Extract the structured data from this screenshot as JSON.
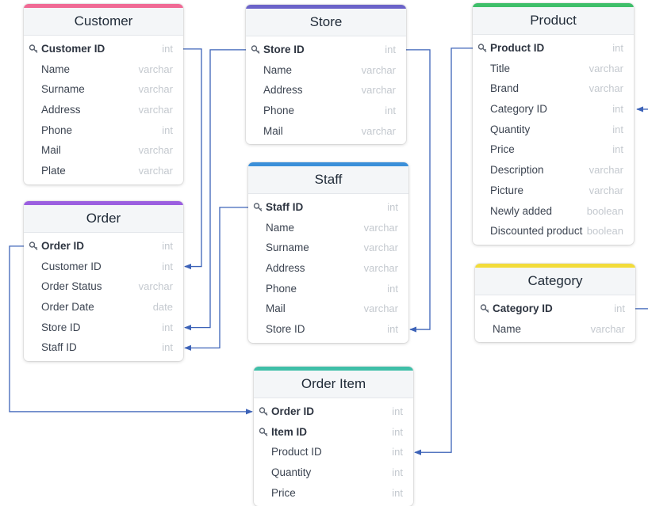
{
  "tables": [
    {
      "id": "customer",
      "name": "Customer",
      "color": "#f06a95",
      "fields": [
        {
          "name": "Customer ID",
          "type": "int",
          "pk": true
        },
        {
          "name": "Name",
          "type": "varchar"
        },
        {
          "name": "Surname",
          "type": "varchar"
        },
        {
          "name": "Address",
          "type": "varchar"
        },
        {
          "name": "Phone",
          "type": "int"
        },
        {
          "name": "Mail",
          "type": "varchar"
        },
        {
          "name": "Plate",
          "type": "varchar"
        }
      ]
    },
    {
      "id": "store",
      "name": "Store",
      "color": "#6b63c9",
      "fields": [
        {
          "name": "Store ID",
          "type": "int",
          "pk": true
        },
        {
          "name": "Name",
          "type": "varchar"
        },
        {
          "name": "Address",
          "type": "varchar"
        },
        {
          "name": "Phone",
          "type": "int"
        },
        {
          "name": "Mail",
          "type": "varchar"
        }
      ]
    },
    {
      "id": "product",
      "name": "Product",
      "color": "#3fbf6a",
      "fields": [
        {
          "name": "Product ID",
          "type": "int",
          "pk": true
        },
        {
          "name": "Title",
          "type": "varchar"
        },
        {
          "name": "Brand",
          "type": "varchar"
        },
        {
          "name": "Category ID",
          "type": "int"
        },
        {
          "name": "Quantity",
          "type": "int"
        },
        {
          "name": "Price",
          "type": "int"
        },
        {
          "name": "Description",
          "type": "varchar"
        },
        {
          "name": "Picture",
          "type": "varchar"
        },
        {
          "name": "Newly added",
          "type": "boolean"
        },
        {
          "name": "Discounted product",
          "type": "boolean"
        }
      ]
    },
    {
      "id": "order",
      "name": "Order",
      "color": "#9b5fe0",
      "fields": [
        {
          "name": "Order ID",
          "type": "int",
          "pk": true
        },
        {
          "name": "Customer ID",
          "type": "int"
        },
        {
          "name": "Order Status",
          "type": "varchar"
        },
        {
          "name": "Order Date",
          "type": "date"
        },
        {
          "name": "Store ID",
          "type": "int"
        },
        {
          "name": "Staff ID",
          "type": "int"
        }
      ]
    },
    {
      "id": "staff",
      "name": "Staff",
      "color": "#3b8fd9",
      "fields": [
        {
          "name": "Staff ID",
          "type": "int",
          "pk": true
        },
        {
          "name": "Name",
          "type": "varchar"
        },
        {
          "name": "Surname",
          "type": "varchar"
        },
        {
          "name": "Address",
          "type": "varchar"
        },
        {
          "name": "Phone",
          "type": "int"
        },
        {
          "name": "Mail",
          "type": "varchar"
        },
        {
          "name": "Store ID",
          "type": "int"
        }
      ]
    },
    {
      "id": "category",
      "name": "Category",
      "color": "#f2dc3a",
      "fields": [
        {
          "name": "Category ID",
          "type": "int",
          "pk": true
        },
        {
          "name": "Name",
          "type": "varchar"
        }
      ]
    },
    {
      "id": "orderitem",
      "name": "Order Item",
      "color": "#3fbfa8",
      "fields": [
        {
          "name": "Order ID",
          "type": "int",
          "pk": true
        },
        {
          "name": "Item ID",
          "type": "int",
          "pk": true
        },
        {
          "name": "Product ID",
          "type": "int"
        },
        {
          "name": "Quantity",
          "type": "int"
        },
        {
          "name": "Price",
          "type": "int"
        }
      ]
    }
  ],
  "relations": [
    {
      "from": [
        "customer",
        0
      ],
      "to": [
        "order",
        1
      ]
    },
    {
      "from": [
        "store",
        0
      ],
      "to": [
        "order",
        4
      ]
    },
    {
      "from": [
        "staff",
        0
      ],
      "to": [
        "order",
        5
      ]
    },
    {
      "from": [
        "store",
        0
      ],
      "to": [
        "staff",
        6
      ]
    },
    {
      "from": [
        "order",
        0
      ],
      "to": [
        "orderitem",
        0
      ]
    },
    {
      "from": [
        "product",
        0
      ],
      "to": [
        "orderitem",
        2
      ]
    },
    {
      "from": [
        "category",
        0
      ],
      "to": [
        "product",
        3
      ]
    }
  ],
  "colors": {
    "connector": "#3d63b8",
    "header_bg": "#f4f6f8",
    "type_text": "#c4c9cf"
  },
  "icons": {
    "primary_key": "key-icon",
    "arrowhead": "arrowhead-icon"
  }
}
